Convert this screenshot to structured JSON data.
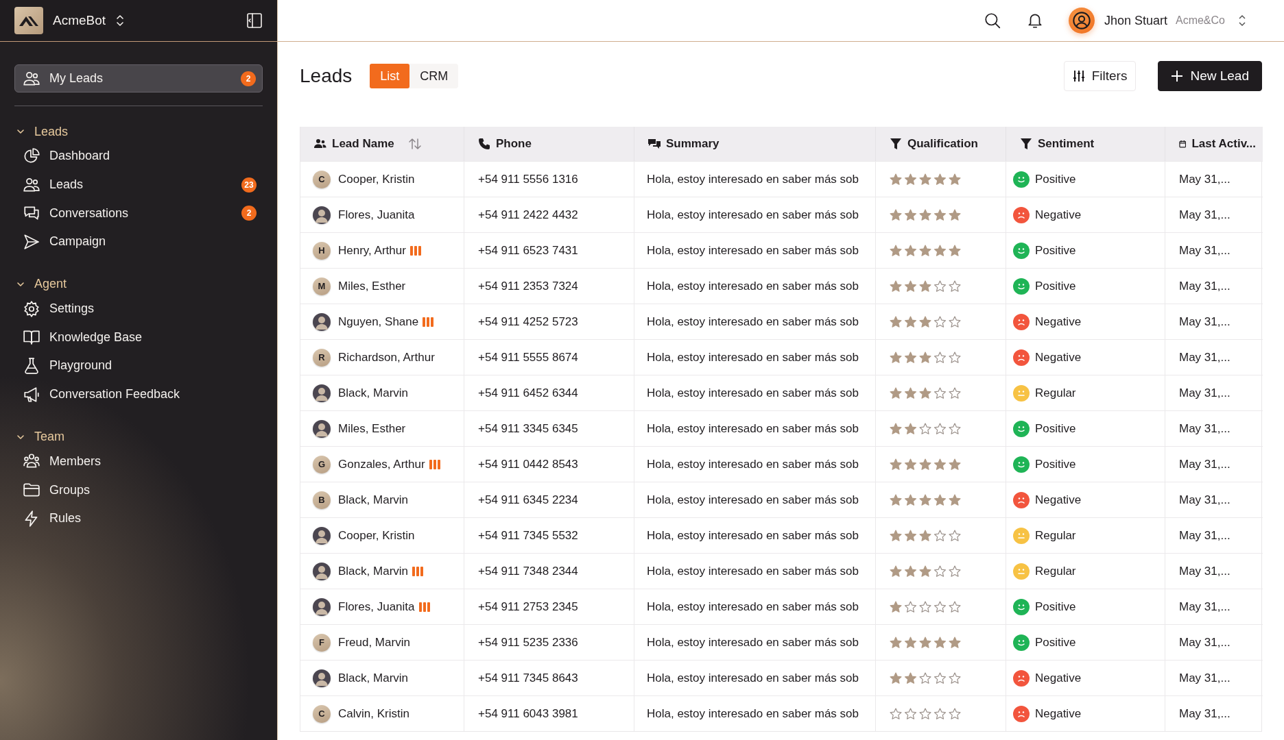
{
  "sidebar": {
    "workspace": "AcmeBot",
    "pinned": {
      "label": "My Leads",
      "badge": "2",
      "selected": true
    },
    "sections": [
      {
        "title": "Leads",
        "expanded": true,
        "items": [
          {
            "label": "Dashboard",
            "selected": false
          },
          {
            "label": "Leads",
            "badge": "23",
            "selected": false
          },
          {
            "label": "Conversations",
            "badge": "2",
            "selected": false
          },
          {
            "label": "Campaign",
            "selected": false
          }
        ]
      },
      {
        "title": "Agent",
        "expanded": true,
        "items": [
          {
            "label": "Settings",
            "selected": false
          },
          {
            "label": "Knowledge Base",
            "selected": false
          },
          {
            "label": "Playground",
            "selected": false
          },
          {
            "label": "Conversation Feedback",
            "selected": false
          }
        ]
      },
      {
        "title": "Team",
        "expanded": true,
        "items": [
          {
            "label": "Members",
            "selected": false
          },
          {
            "label": "Groups",
            "selected": false
          },
          {
            "label": "Rules",
            "selected": false
          }
        ]
      }
    ]
  },
  "topbar": {
    "user": "Jhon Stuart",
    "organization": "Acme&Co"
  },
  "page": {
    "title": "Leads",
    "tabs": [
      {
        "label": "List",
        "selected": true
      },
      {
        "label": "CRM",
        "selected": false
      }
    ],
    "buttons": [
      {
        "label": "Filters",
        "kind": "filter"
      },
      {
        "label": "New Lead",
        "kind": "primary"
      }
    ]
  },
  "table": {
    "columns": [
      {
        "label": "Lead Name",
        "sortable": true
      },
      {
        "label": "Phone",
        "sortable": false
      },
      {
        "label": "Summary",
        "sortable": false
      },
      {
        "label": "Qualification",
        "sortable": false
      },
      {
        "label": "Sentiment",
        "sortable": false
      },
      {
        "label": "Last Activ...",
        "sortable": false
      }
    ],
    "rows": [
      {
        "avatar": {
          "kind": "initial",
          "text": "C"
        },
        "name": "Cooper, Kristin",
        "flagged": false,
        "phone": "+54 911 5556 1316",
        "summary": "Hola, estoy interesado en saber más sob",
        "stars": 5,
        "sentiment": {
          "label": "Positive",
          "kind": "positive"
        },
        "last_activity": "May 31,..."
      },
      {
        "avatar": {
          "kind": "photo"
        },
        "name": "Flores, Juanita",
        "flagged": false,
        "phone": "+54 911 2422 4432",
        "summary": "Hola, estoy interesado en saber más sob",
        "stars": 5,
        "sentiment": {
          "label": "Negative",
          "kind": "negative"
        },
        "last_activity": "May 31,..."
      },
      {
        "avatar": {
          "kind": "initial",
          "text": "H"
        },
        "name": "Henry, Arthur",
        "flagged": true,
        "phone": "+54 911 6523 7431",
        "summary": "Hola, estoy interesado en saber más sob",
        "stars": 5,
        "sentiment": {
          "label": "Positive",
          "kind": "positive"
        },
        "last_activity": "May 31,..."
      },
      {
        "avatar": {
          "kind": "initial",
          "text": "M"
        },
        "name": "Miles, Esther",
        "flagged": false,
        "phone": "+54 911 2353 7324",
        "summary": "Hola, estoy interesado en saber más sob",
        "stars": 3,
        "sentiment": {
          "label": "Positive",
          "kind": "positive"
        },
        "last_activity": "May 31,..."
      },
      {
        "avatar": {
          "kind": "photo"
        },
        "name": "Nguyen, Shane",
        "flagged": true,
        "phone": "+54 911 4252 5723",
        "summary": "Hola, estoy interesado en saber más sob",
        "stars": 3,
        "sentiment": {
          "label": "Negative",
          "kind": "negative"
        },
        "last_activity": "May 31,..."
      },
      {
        "avatar": {
          "kind": "initial",
          "text": "R"
        },
        "name": "Richardson, Arthur",
        "flagged": false,
        "phone": "+54 911 5555 8674",
        "summary": "Hola, estoy interesado en saber más sob",
        "stars": 3,
        "sentiment": {
          "label": "Negative",
          "kind": "negative"
        },
        "last_activity": "May 31,..."
      },
      {
        "avatar": {
          "kind": "photo"
        },
        "name": "Black, Marvin",
        "flagged": false,
        "phone": "+54 911 6452 6344",
        "summary": "Hola, estoy interesado en saber más sob",
        "stars": 3,
        "sentiment": {
          "label": "Regular",
          "kind": "regular"
        },
        "last_activity": "May 31,..."
      },
      {
        "avatar": {
          "kind": "photo"
        },
        "name": "Miles, Esther",
        "flagged": false,
        "phone": "+54 911 3345 6345",
        "summary": "Hola, estoy interesado en saber más sob",
        "stars": 2,
        "sentiment": {
          "label": "Positive",
          "kind": "positive"
        },
        "last_activity": "May 31,..."
      },
      {
        "avatar": {
          "kind": "initial",
          "text": "G"
        },
        "name": "Gonzales, Arthur",
        "flagged": true,
        "phone": "+54 911 0442 8543",
        "summary": "Hola, estoy interesado en saber más sob",
        "stars": 5,
        "sentiment": {
          "label": "Positive",
          "kind": "positive"
        },
        "last_activity": "May 31,..."
      },
      {
        "avatar": {
          "kind": "initial",
          "text": "B"
        },
        "name": "Black, Marvin",
        "flagged": false,
        "phone": "+54 911 6345 2234",
        "summary": "Hola, estoy interesado en saber más sob",
        "stars": 5,
        "sentiment": {
          "label": "Negative",
          "kind": "negative"
        },
        "last_activity": "May 31,..."
      },
      {
        "avatar": {
          "kind": "photo"
        },
        "name": "Cooper, Kristin",
        "flagged": false,
        "phone": "+54 911 7345 5532",
        "summary": "Hola, estoy interesado en saber más sob",
        "stars": 3,
        "sentiment": {
          "label": "Regular",
          "kind": "regular"
        },
        "last_activity": "May 31,..."
      },
      {
        "avatar": {
          "kind": "photo"
        },
        "name": "Black, Marvin",
        "flagged": true,
        "phone": "+54 911 7348 2344",
        "summary": "Hola, estoy interesado en saber más sob",
        "stars": 3,
        "sentiment": {
          "label": "Regular",
          "kind": "regular"
        },
        "last_activity": "May 31,..."
      },
      {
        "avatar": {
          "kind": "photo"
        },
        "name": "Flores, Juanita",
        "flagged": true,
        "phone": "+54 911 2753 2345",
        "summary": "Hola, estoy interesado en saber más sob",
        "stars": 1,
        "sentiment": {
          "label": "Positive",
          "kind": "positive"
        },
        "last_activity": "May 31,..."
      },
      {
        "avatar": {
          "kind": "initial",
          "text": "F"
        },
        "name": "Freud, Marvin",
        "flagged": false,
        "phone": "+54 911 5235 2336",
        "summary": "Hola, estoy interesado en saber más sob",
        "stars": 5,
        "sentiment": {
          "label": "Positive",
          "kind": "positive"
        },
        "last_activity": "May 31,..."
      },
      {
        "avatar": {
          "kind": "photo"
        },
        "name": "Black, Marvin",
        "flagged": false,
        "phone": "+54 911 7345 8643",
        "summary": "Hola, estoy interesado en saber más sob",
        "stars": 2,
        "sentiment": {
          "label": "Negative",
          "kind": "negative"
        },
        "last_activity": "May 31,..."
      },
      {
        "avatar": {
          "kind": "initial",
          "text": "C"
        },
        "name": "Calvin, Kristin",
        "flagged": false,
        "phone": "+54 911 6043 3981",
        "summary": "Hola, estoy interesado en saber más sob",
        "stars": 0,
        "sentiment": {
          "label": "Negative",
          "kind": "negative"
        },
        "last_activity": "May 31,..."
      }
    ]
  }
}
